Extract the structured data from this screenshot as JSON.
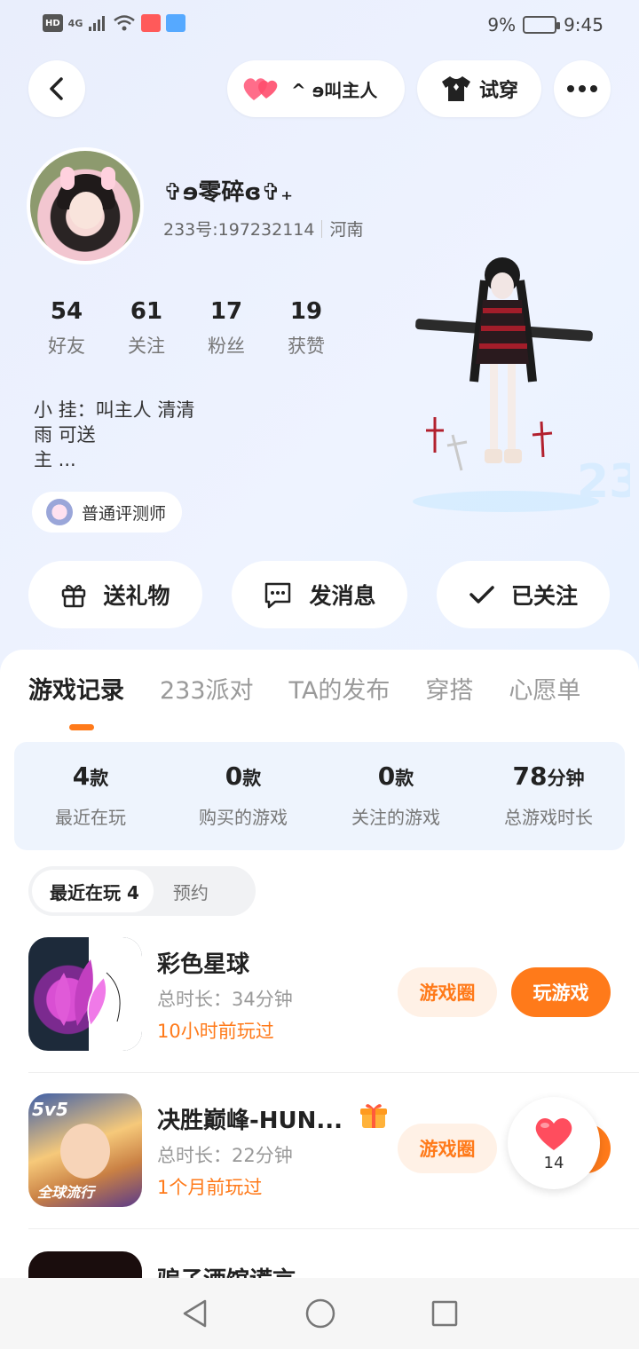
{
  "status_bar": {
    "hd": "HD",
    "net": "4G",
    "battery": "9%",
    "time": "9:45"
  },
  "header": {
    "fav_label": "^ ɘ叫主人",
    "try_on": "试穿"
  },
  "profile": {
    "nickname": "✞ɘ零碎ɞ✞₊",
    "uid": "233号:197232114",
    "region": "河南",
    "stats": [
      {
        "value": "54",
        "label": "好友"
      },
      {
        "value": "61",
        "label": "关注"
      },
      {
        "value": "17",
        "label": "粉丝"
      },
      {
        "value": "19",
        "label": "获赞"
      }
    ],
    "bio_lines": [
      "小 挂：叫主人 清清",
      "雨 可送",
      "主 ..."
    ],
    "badge": "普通评测师"
  },
  "actions": {
    "gift": "送礼物",
    "message": "发消息",
    "follow": "已关注"
  },
  "tabs": [
    "游戏记录",
    "233派对",
    "TA的发布",
    "穿搭",
    "心愿单"
  ],
  "summary": [
    {
      "value": "4",
      "unit": "款",
      "label": "最近在玩"
    },
    {
      "value": "0",
      "unit": "款",
      "label": "购买的游戏"
    },
    {
      "value": "0",
      "unit": "款",
      "label": "关注的游戏"
    },
    {
      "value": "78",
      "unit": "分钟",
      "label": "总游戏时长"
    }
  ],
  "segment": {
    "recent": "最近在玩 4",
    "reserve": "预约"
  },
  "games": [
    {
      "name": "彩色星球",
      "duration": "总时长：34分钟",
      "last_played": "10小时前玩过",
      "circle": "游戏圈",
      "play": "玩游戏"
    },
    {
      "name": "决胜巅峰-HUN...",
      "duration": "总时长：22分钟",
      "last_played": "1个月前玩过",
      "circle": "游戏圈",
      "icon_tag": "5v5",
      "icon_tag2": "全球流行"
    },
    {
      "name": "骗子酒馆谎言"
    }
  ],
  "floating_like": {
    "count": "14"
  },
  "colors": {
    "accent": "#ff7a1a",
    "heart": "#ff4d5e"
  }
}
